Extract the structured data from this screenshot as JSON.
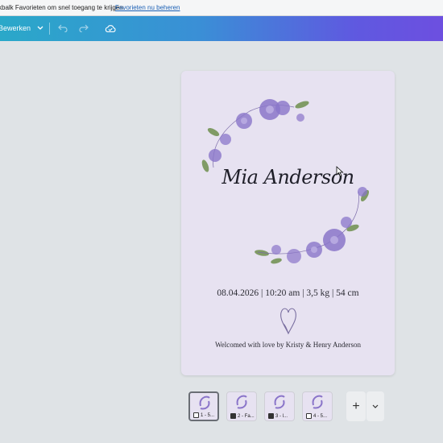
{
  "favorites_bar": {
    "message": "kbalk Favorieten om snel toegang te krijgen.",
    "link": "Favorieten nu beheren"
  },
  "toolbar": {
    "edit_label": "Bewerken",
    "edit_icon": "chevron-down-icon",
    "undo_icon": "undo-icon",
    "redo_icon": "redo-icon",
    "save_icon": "cloud-sync-icon"
  },
  "design": {
    "background_color": "#e7e2f1",
    "name": "Mia Anderson",
    "details": "08.04.2026 | 10:20 am | 3,5 kg | 54 cm",
    "welcome": "Welcomed with love by Kristy & Henry Anderson",
    "decoration": "purple-flower-wreath"
  },
  "pages": [
    {
      "label": "1 - 5...",
      "active": true
    },
    {
      "label": "2 - Fa...",
      "active": false
    },
    {
      "label": "3 - l...",
      "active": false
    },
    {
      "label": "4 - 5...",
      "active": false
    }
  ],
  "controls": {
    "add": "+",
    "more": "⌄"
  },
  "colors": {
    "toolbar_start": "#2aa8c9",
    "toolbar_end": "#6d4fe0",
    "flower": "#8a75c9",
    "leaf": "#6f8f4e"
  }
}
